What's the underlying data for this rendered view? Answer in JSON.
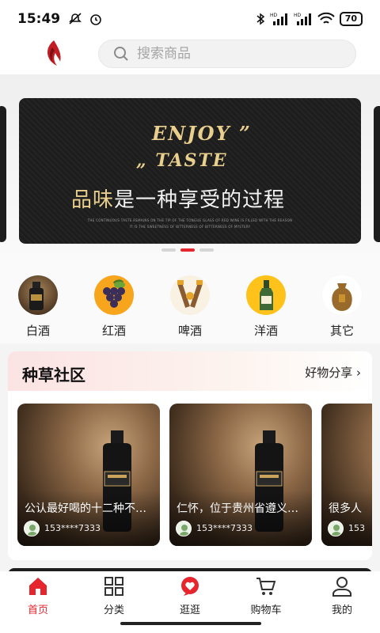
{
  "status_bar": {
    "time": "15:49",
    "battery": "70",
    "icons": [
      "mute-icon",
      "alarm-icon",
      "bluetooth-icon",
      "signal-hd-icon",
      "signal-hd-icon",
      "wifi-icon",
      "battery-icon"
    ]
  },
  "header": {
    "logo": "flame-logo",
    "search_placeholder": "搜索商品"
  },
  "banner": {
    "line1": "ENJOY ”",
    "line2": "„ TASTE",
    "slogan_gold": "品味",
    "slogan_white": "是一种享受的过程",
    "small_line1": "THE CONTINUOUS TASTE REMAINS ON THE TIP OF THE TONGUE GLASS OF RED WINE IS FILLED WITH THE REASON",
    "small_line2": "IT IS THE SWEETNESS OF BITTERNESS OF BITTERNESS OF MYSTERY",
    "slides": 3,
    "active_slide": 2
  },
  "categories": [
    {
      "label": "白酒",
      "icon": "baijiu-bottle-icon"
    },
    {
      "label": "红酒",
      "icon": "grapes-icon"
    },
    {
      "label": "啤酒",
      "icon": "beer-icon"
    },
    {
      "label": "洋酒",
      "icon": "champagne-icon"
    },
    {
      "label": "其它",
      "icon": "jar-icon"
    }
  ],
  "community": {
    "title": "种草社区",
    "more": "好物分享 ›",
    "posts": [
      {
        "title": "公认最好喝的十二种不…",
        "user": "153****7333"
      },
      {
        "title": "仁怀，位于贵州省遵义…",
        "user": "153****7333"
      },
      {
        "title": "很多人",
        "user": "153"
      }
    ]
  },
  "tabbar": [
    {
      "label": "首页",
      "icon": "home-icon",
      "active": true
    },
    {
      "label": "分类",
      "icon": "grid-icon",
      "active": false
    },
    {
      "label": "逛逛",
      "icon": "heart-bubble-icon",
      "active": false
    },
    {
      "label": "购物车",
      "icon": "cart-icon",
      "active": false
    },
    {
      "label": "我的",
      "icon": "user-icon",
      "active": false
    }
  ],
  "colors": {
    "accent": "#e6262e",
    "banner_gold": "#e9cf8d"
  }
}
